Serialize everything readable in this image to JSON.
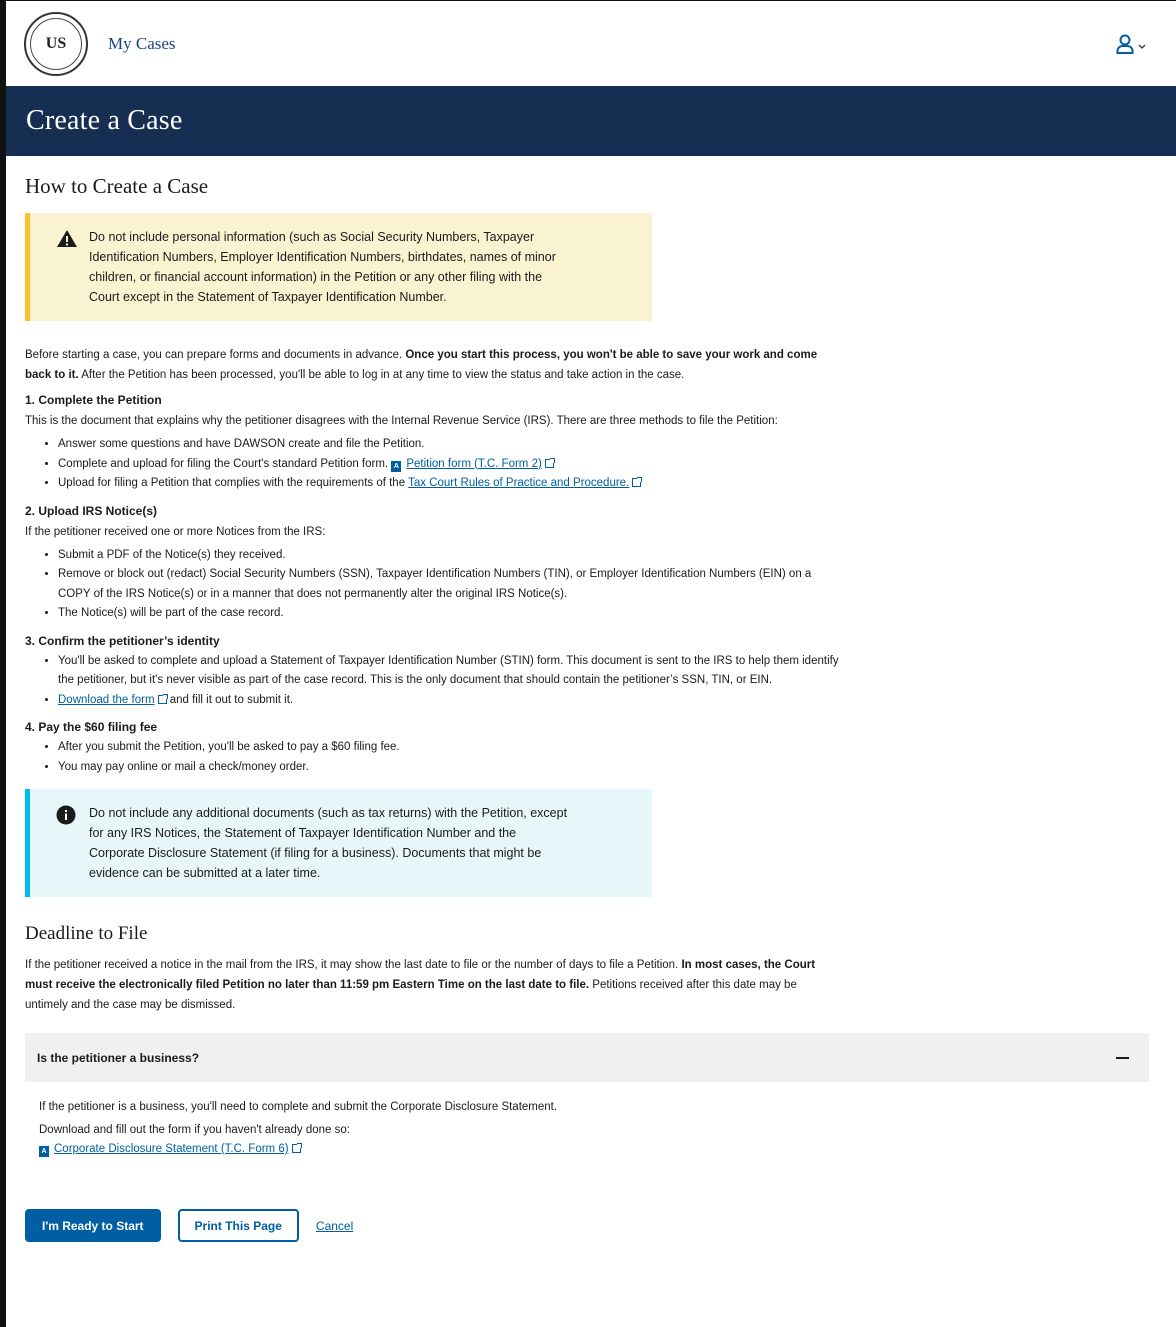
{
  "header": {
    "seal_text": "US",
    "nav_link": "My Cases"
  },
  "banner": {
    "title": "Create a Case"
  },
  "how": {
    "heading": "How to Create a Case",
    "warning": "Do not include personal information (such as Social Security Numbers, Taxpayer Identification Numbers, Employer Identification Numbers, birthdates, names of minor children, or financial account information) in the Petition or any other filing with the Court except in the Statement of Taxpayer Identification Number.",
    "intro_a": "Before starting a case, you can prepare forms and documents in advance. ",
    "intro_bold": "Once you start this process, you won't be able to save your work and come back to it.",
    "intro_b": " After the Petition has been processed, you'll be able to log in at any time to view the status and take action in the case.",
    "step1": {
      "title": "1. Complete the Petition",
      "desc": "This is the document that explains why the petitioner disagrees with the Internal Revenue Service (IRS). There are three methods to file the Petition:",
      "b1": "Answer some questions and have DAWSON create and file the Petition.",
      "b2": "Complete and upload for filing the Court's standard Petition form.",
      "b2_link": "Petition form (T.C. Form 2)",
      "b3": "Upload for filing a Petition that complies with the requirements of the",
      "b3_link": "Tax Court Rules of Practice and Procedure."
    },
    "step2": {
      "title": "2. Upload IRS Notice(s)",
      "desc": "If the petitioner received one or more Notices from the IRS:",
      "b1": "Submit a PDF of the Notice(s) they received.",
      "b2": "Remove or block out (redact) Social Security Numbers (SSN), Taxpayer Identification Numbers (TIN), or Employer Identification Numbers (EIN) on a COPY of the IRS Notice(s) or in a manner that does not permanently alter the original IRS Notice(s).",
      "b3": "The Notice(s) will be part of the case record."
    },
    "step3": {
      "title": "3. Confirm the petitioner’s identity",
      "b1": "You'll be asked to complete and upload a Statement of Taxpayer Identification Number (STIN) form. This document is sent to the IRS to help them identify the petitioner, but it's never visible as part of the case record. This is the only document that should contain the petitioner’s SSN, TIN, or EIN.",
      "b2_link": "Download the form",
      "b2": " and fill it out to submit it."
    },
    "step4": {
      "title": "4. Pay the $60 filing fee",
      "b1": "After you submit the Petition, you'll be asked to pay a $60 filing fee.",
      "b2": "You may pay online or mail a check/money order."
    },
    "info": "Do not include any additional documents (such as tax returns) with the Petition, except for any IRS Notices, the Statement of Taxpayer Identification Number and the Corporate Disclosure Statement (if filing for a business). Documents that might be evidence can be submitted at a later time."
  },
  "deadline": {
    "heading": "Deadline to File",
    "text_a": "If the petitioner received a notice in the mail from the IRS, it may show the last date to file or the number of days to file a Petition. ",
    "text_bold": "In most cases, the Court must receive the electronically filed Petition no later than 11:59 pm Eastern Time on the last date to file.",
    "text_b": " Petitions received after this date may be untimely and the case may be dismissed."
  },
  "accordion": {
    "title": "Is the petitioner a business?",
    "p1": "If the petitioner is a business, you'll need to complete and submit the Corporate Disclosure Statement.",
    "p2": "Download and fill out the form if you haven't already done so:",
    "link": "Corporate Disclosure Statement (T.C. Form 6)"
  },
  "actions": {
    "start": "I'm Ready to Start",
    "print": "Print This Page",
    "cancel": "Cancel"
  }
}
